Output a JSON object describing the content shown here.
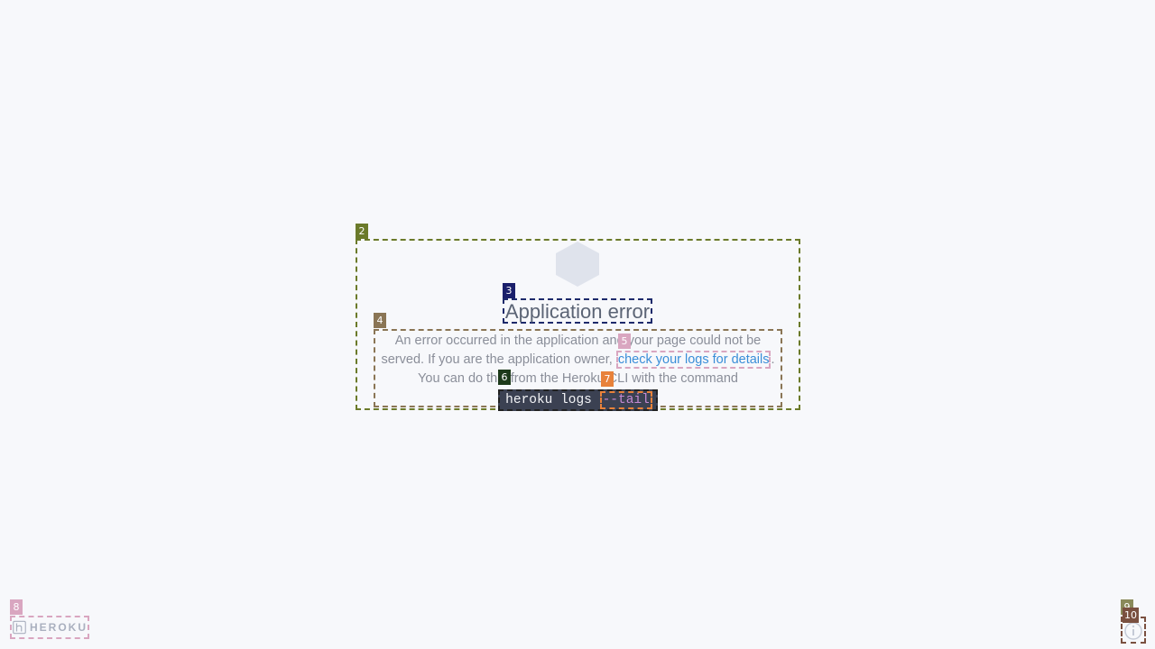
{
  "error": {
    "title": "Application error",
    "message_part1": "An error occurred in the application and your page could not be served. If you are the application owner, ",
    "logs_link": "check your logs for details",
    "message_part2": ". You can do this from the Heroku CLI with the command",
    "command": "heroku logs ",
    "command_flag": "--tail"
  },
  "footer": {
    "logo_text": "HEROKU",
    "info_icon": "info-icon"
  },
  "marks": {
    "m2": "2",
    "m3": "3",
    "m4": "4",
    "m5": "5",
    "m6": "6",
    "m7": "7",
    "m8": "8",
    "m9": "9",
    "m10": "10"
  },
  "colors": {
    "background": "#f7f8fb",
    "link": "#3a8ed8",
    "title_text": "#5b6475",
    "body_text": "#8a8e99",
    "command_bg": "#3b4152",
    "command_flag": "#c58ad4"
  }
}
